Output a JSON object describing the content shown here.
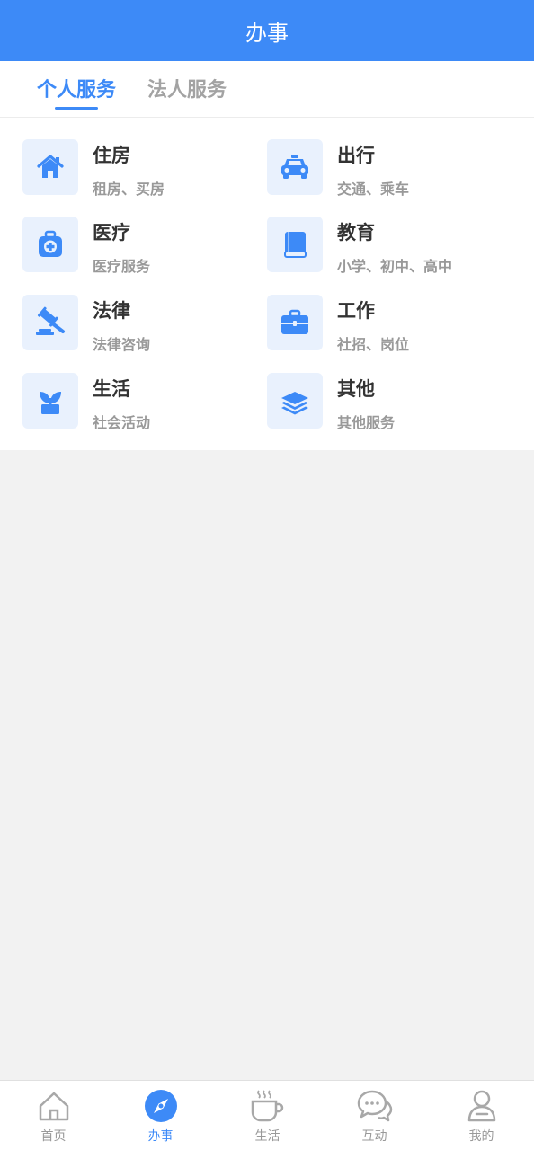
{
  "header": {
    "title": "办事"
  },
  "tabs": [
    {
      "label": "个人服务",
      "active": true
    },
    {
      "label": "法人服务",
      "active": false
    }
  ],
  "services": [
    {
      "title": "住房",
      "subtitle": "租房、买房",
      "icon": "house-icon"
    },
    {
      "title": "出行",
      "subtitle": "交通、乘车",
      "icon": "taxi-icon"
    },
    {
      "title": "医疗",
      "subtitle": "医疗服务",
      "icon": "medical-kit-icon"
    },
    {
      "title": "教育",
      "subtitle": "小学、初中、高中",
      "icon": "book-icon"
    },
    {
      "title": "法律",
      "subtitle": "法律咨询",
      "icon": "gavel-icon"
    },
    {
      "title": "工作",
      "subtitle": "社招、岗位",
      "icon": "briefcase-icon"
    },
    {
      "title": "生活",
      "subtitle": "社会活动",
      "icon": "plant-icon"
    },
    {
      "title": "其他",
      "subtitle": "其他服务",
      "icon": "layers-icon"
    }
  ],
  "tabbar": [
    {
      "label": "首页",
      "icon": "home-outline-icon",
      "active": false
    },
    {
      "label": "办事",
      "icon": "compass-icon",
      "active": true
    },
    {
      "label": "生活",
      "icon": "coffee-cup-icon",
      "active": false
    },
    {
      "label": "互动",
      "icon": "chat-bubbles-icon",
      "active": false
    },
    {
      "label": "我的",
      "icon": "user-icon",
      "active": false
    }
  ],
  "colors": {
    "primary": "#3d8af7",
    "icon_bg": "#e9f1fd",
    "title_text": "#333333",
    "sub_text": "#999999",
    "page_bg": "#f2f2f2"
  }
}
